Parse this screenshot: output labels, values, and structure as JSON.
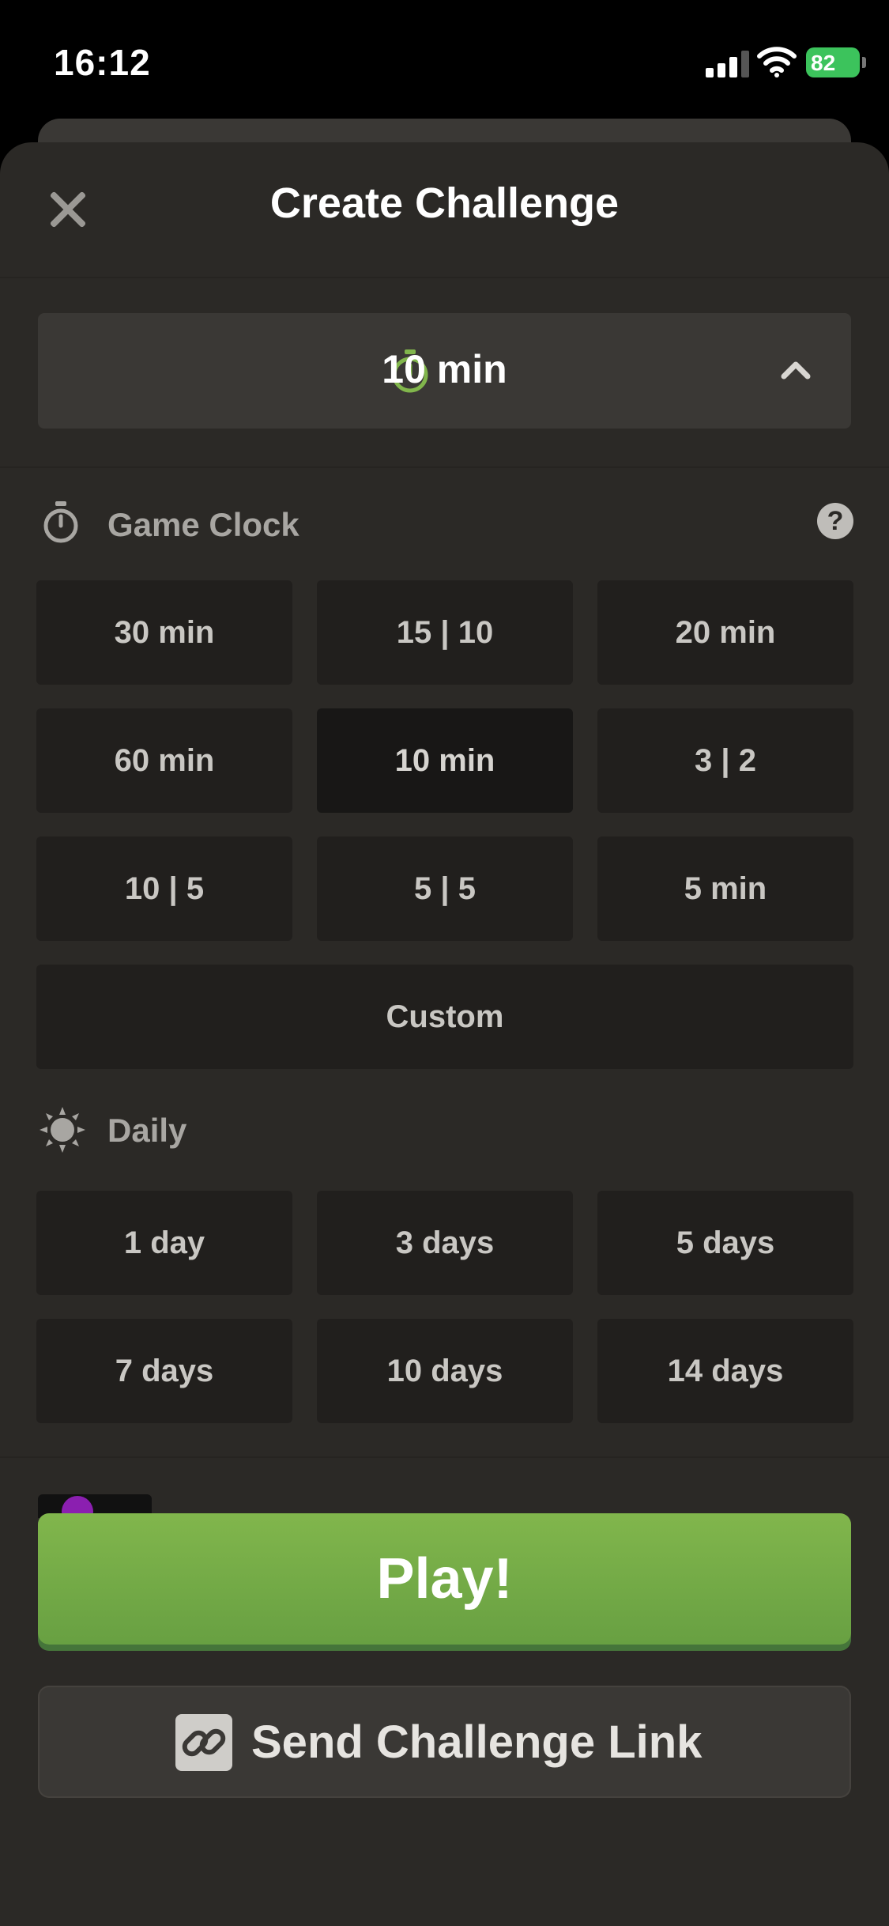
{
  "status_bar": {
    "time": "16:12",
    "battery": "82"
  },
  "header": {
    "title": "Create Challenge"
  },
  "time_selector": {
    "value": "10 min"
  },
  "game_clock": {
    "heading": "Game Clock",
    "help": "?",
    "options": [
      "30 min",
      "15 | 10",
      "20 min",
      "60 min",
      "10 min",
      "3 | 2",
      "10 | 5",
      "5 | 5",
      "5 min"
    ],
    "selected": "10 min",
    "custom": "Custom"
  },
  "daily": {
    "heading": "Daily",
    "options": [
      "1 day",
      "3 days",
      "5 days",
      "7 days",
      "10 days",
      "14 days"
    ]
  },
  "actions": {
    "play": "Play!",
    "send_link": "Send Challenge Link"
  },
  "colors": {
    "accent_green": "#81b64c",
    "sheet_bg": "#2b2926",
    "option_bg": "#211f1d"
  }
}
